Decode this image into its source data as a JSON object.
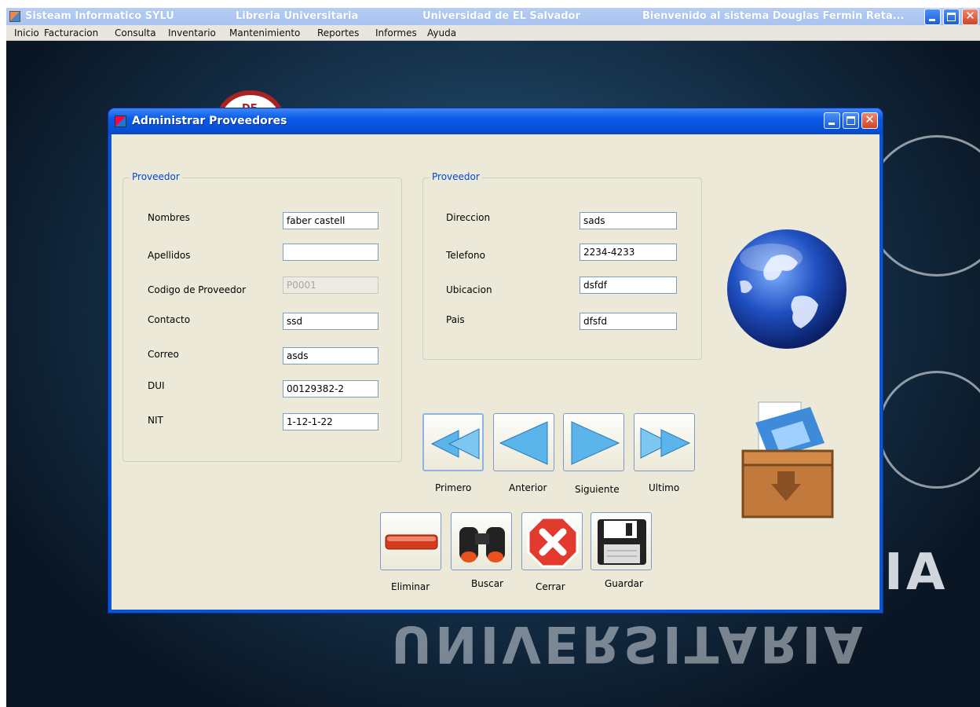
{
  "main_window": {
    "title_parts": [
      "Sisteam Informatico SYLU",
      "Libreria Universitaria",
      "Universidad de EL Salvador",
      "Bienvenido al sistema Douglas Fermin Reta..."
    ]
  },
  "menu": {
    "items": [
      "Inicio",
      "Facturacion",
      "Consulta",
      "Inventario",
      "Mantenimiento",
      "Reportes",
      "Informes",
      "Ayuda"
    ]
  },
  "background": {
    "banner_text": "UNIVERSITARIA",
    "banner_partial": "IA",
    "seal_text": "DE"
  },
  "dialog": {
    "title": "Administrar Proveedores",
    "group_left": {
      "legend": "Proveedor",
      "fields": [
        {
          "label": "Nombres",
          "value": "faber castell"
        },
        {
          "label": "Apellidos",
          "value": ""
        },
        {
          "label": "Codigo de Proveedor",
          "value": "P0001"
        },
        {
          "label": "Contacto",
          "value": "ssd"
        },
        {
          "label": "Correo",
          "value": "asds"
        },
        {
          "label": "DUI",
          "value": "00129382-2"
        },
        {
          "label": "NIT",
          "value": "1-12-1-22"
        }
      ]
    },
    "group_right": {
      "legend": "Proveedor",
      "fields": [
        {
          "label": "Direccion",
          "value": "sads"
        },
        {
          "label": "Telefono",
          "value": "2234-4233"
        },
        {
          "label": "Ubicacion",
          "value": "dsfdf"
        },
        {
          "label": "Pais",
          "value": "dfsfd"
        }
      ]
    },
    "nav": {
      "first": "Primero",
      "previous": "Anterior",
      "next": "Siguiente",
      "last": "Ultimo"
    },
    "actions": {
      "delete": "Eliminar",
      "search": "Buscar",
      "close": "Cerrar",
      "save": "Guardar"
    }
  },
  "colors": {
    "dialog_bg": "#ece9d8",
    "title_blue": "#0a5ae8",
    "legend_blue": "#0046d5",
    "nav_arrow": "#3fa6e0"
  }
}
